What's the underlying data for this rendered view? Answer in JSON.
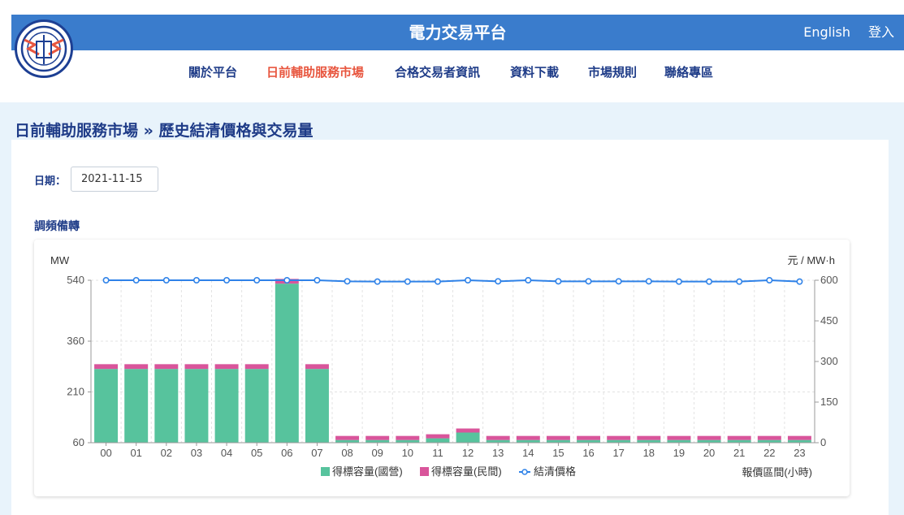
{
  "header": {
    "title": "電力交易平台",
    "english_link": "English",
    "login_link": "登入"
  },
  "nav": [
    {
      "label": "關於平台",
      "active": false
    },
    {
      "label": "日前輔助服務市場",
      "active": true
    },
    {
      "label": "合格交易者資訊",
      "active": false
    },
    {
      "label": "資料下載",
      "active": false
    },
    {
      "label": "市場規則",
      "active": false
    },
    {
      "label": "聯絡專區",
      "active": false
    }
  ],
  "page": {
    "title": "日前輔助服務市場 » 歷史結清價格與交易量"
  },
  "filter": {
    "date_label": "日期：",
    "date_value": "2021-11-15"
  },
  "section": {
    "title": "調頻備轉"
  },
  "colors": {
    "header_bg": "#3a7ccc",
    "nav_text": "#1f3c88",
    "nav_active": "#e8563f",
    "green": "#57c39d",
    "pink": "#d9559b",
    "line": "#2f82e8"
  },
  "chart_data": {
    "type": "bar",
    "ylabel": "MW",
    "y2label": "元 / MW·h",
    "xlabel": "報價區間(小時)",
    "ylim": [
      60,
      540
    ],
    "yticks": [
      60,
      210,
      360,
      540
    ],
    "y2lim": [
      0,
      600
    ],
    "y2ticks": [
      0,
      150,
      300,
      450,
      600
    ],
    "categories": [
      "00",
      "01",
      "02",
      "03",
      "04",
      "05",
      "06",
      "07",
      "08",
      "09",
      "10",
      "11",
      "12",
      "13",
      "14",
      "15",
      "16",
      "17",
      "18",
      "19",
      "20",
      "21",
      "22",
      "23"
    ],
    "series": [
      {
        "name": "得標容量(國營)",
        "type": "bar",
        "stack": true,
        "color": "#57c39d",
        "values": [
          278,
          278,
          278,
          278,
          278,
          278,
          530,
          278,
          68,
          68,
          68,
          73,
          90,
          68,
          68,
          68,
          68,
          68,
          68,
          68,
          68,
          68,
          68,
          68
        ]
      },
      {
        "name": "得標容量(民間)",
        "type": "bar",
        "stack": true,
        "color": "#d9559b",
        "values": [
          14,
          14,
          14,
          14,
          14,
          14,
          14,
          14,
          12,
          12,
          12,
          12,
          12,
          12,
          12,
          12,
          12,
          12,
          12,
          12,
          12,
          12,
          12,
          12
        ]
      },
      {
        "name": "結清價格",
        "type": "line",
        "axis": "right",
        "color": "#2f82e8",
        "values": [
          600,
          600,
          600,
          600,
          600,
          600,
          600,
          600,
          596,
          595,
          595,
          595,
          600,
          596,
          600,
          596,
          596,
          596,
          596,
          595,
          595,
          595,
          600,
          595
        ]
      }
    ],
    "grid": true,
    "legend": "bottom"
  }
}
